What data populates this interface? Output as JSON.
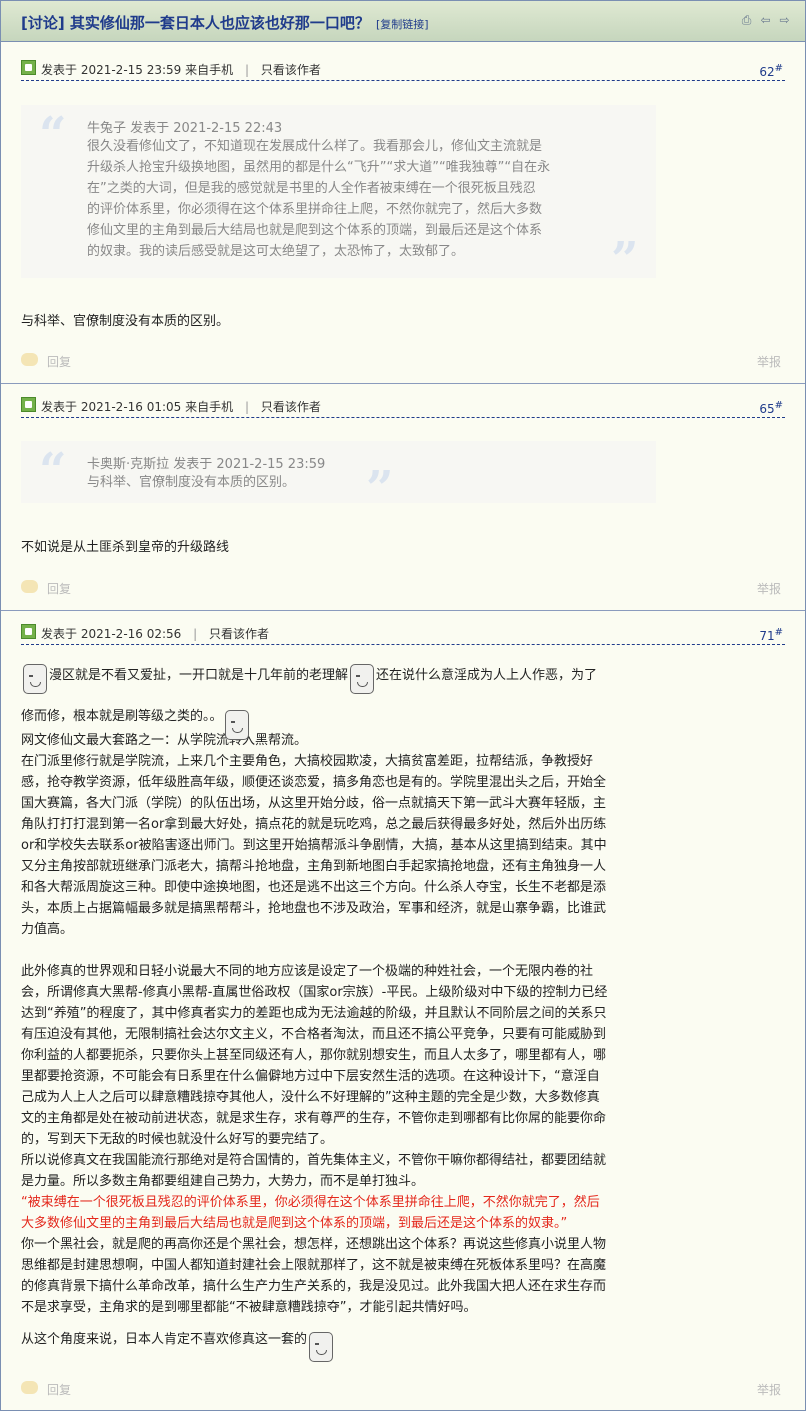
{
  "thread": {
    "title": "[讨论] 其实修仙那一套日本人也应该也好那一口吧？",
    "copy_link": "[复制链接]"
  },
  "header_icons": [
    "print-icon",
    "prev-arrow-icon",
    "next-arrow-icon"
  ],
  "posts": [
    {
      "meta_posted": "发表于 2021-2-15 23:59 来自手机",
      "only_author": "只看该作者",
      "floor_num": "62",
      "floor_sup": "#",
      "quote_head": "牛兔子 发表于 2021-2-15 22:43",
      "quote_lines": [
        "很久没看修仙文了，不知道现在发展成什么样了。我看那会儿，修仙文主流就是",
        "升级杀人抢宝升级换地图，虽然用的都是什么“飞升”“求大道”“唯我独尊”“自在永",
        "在”之类的大词，但是我的感觉就是书里的人全作者被束缚在一个很死板且残忍",
        "的评价体系里，你必须得在这个体系里拼命往上爬，不然你就完了，然后大多数",
        "修仙文里的主角到最后大结局也就是爬到这个体系的顶端，到最后还是这个体系",
        "的奴隶。我的读后感受就是这可太绝望了，太恐怖了，太致郁了。"
      ],
      "body": "与科举、官僚制度没有本质的区别。",
      "reply": "回复",
      "report": "举报"
    },
    {
      "meta_posted": "发表于 2021-2-16 01:05 来自手机",
      "only_author": "只看该作者",
      "floor_num": "65",
      "floor_sup": "#",
      "quote_head": "卡奥斯·克斯拉 发表于 2021-2-15 23:59",
      "quote_lines": [
        "与科举、官僚制度没有本质的区别。"
      ],
      "body": "不如说是从土匪杀到皇帝的升级路线",
      "reply": "回复",
      "report": "举报"
    },
    {
      "meta_posted": "发表于 2021-2-16 02:56",
      "only_author": "只看该作者",
      "floor_num": "71",
      "floor_sup": "#",
      "line1a": "漫区就是不看又爱扯，一开口就是十几年前的老理解",
      "line1b": "还在说什么意淫成为人上人作恶，为了",
      "line2": "修而修，根本就是刷等级之类的。。",
      "lines": [
        "网文修仙文最大套路之一：从学院流转入黑帮流。",
        "在门派里修行就是学院流，上来几个主要角色，大搞校园欺凌，大搞贫富差距，拉帮结派，争教授好",
        "感，抢夺教学资源，低年级胜高年级，顺便还谈恋爱，搞多角恋也是有的。学院里混出头之后，开始全",
        "国大赛篇，各大门派（学院）的队伍出场，从这里开始分歧，俗一点就搞天下第一武斗大赛年轻版，主",
        "角队打打打混到第一名or拿到最大好处，搞点花的就是玩吃鸡，总之最后获得最多好处，然后外出历练",
        "or和学校失去联系or被陷害逐出师门。到这里开始搞帮派斗争剧情，大搞，基本从这里搞到结束。其中",
        "又分主角按部就班继承门派老大，搞帮斗抢地盘，主角到新地图白手起家搞抢地盘，还有主角独身一人",
        "和各大帮派周旋这三种。即使中途换地图，也还是逃不出这三个方向。什么杀人夺宝，长生不老都是添",
        "头，本质上占据篇幅最多就是搞黑帮帮斗，抢地盘也不涉及政治，军事和经济，就是山寨争霸，比谁武",
        "力值高。",
        "",
        "此外修真的世界观和日轻小说最大不同的地方应该是设定了一个极端的种姓社会，一个无限内卷的社",
        "会，所谓修真大黑帮-修真小黑帮-直属世俗政权（国家or宗族）-平民。上级阶级对中下级的控制力已经",
        "达到“养殖”的程度了，其中修真者实力的差距也成为无法逾越的阶级，并且默认不同阶层之间的关系只",
        "有压迫没有其他，无限制搞社会达尔文主义，不合格者淘汰，而且还不搞公平竞争，只要有可能威胁到",
        "你利益的人都要扼杀，只要你头上甚至同级还有人，那你就别想安生，而且人太多了，哪里都有人，哪",
        "里都要抢资源，不可能会有日系里在什么偏僻地方过中下层安然生活的选项。在这种设计下，“意淫自",
        "己成为人上人之后可以肆意糟践掠夺其他人，没什么不好理解的”这种主题的完全是少数，大多数修真",
        "文的主角都是处在被动前进状态，就是求生存，求有尊严的生存，不管你走到哪都有比你屌的能要你命",
        "的，写到天下无敌的时候也就没什么好写的要完结了。",
        "所以说修真文在我国能流行那绝对是符合国情的，首先集体主义，不管你干嘛你都得结社，都要团结就",
        "是力量。所以多数主角都要组建自己势力，大势力，而不是单打独斗。"
      ],
      "red_lines": [
        "“被束缚在一个很死板且残忍的评价体系里，你必须得在这个体系里拼命往上爬，不然你就完了，然后",
        "大多数修仙文里的主角到最后大结局也就是爬到这个体系的顶端，到最后还是这个体系的奴隶。”"
      ],
      "after_lines": [
        "你一个黑社会，就是爬的再高你还是个黑社会，想怎样，还想跳出这个体系？再说这些修真小说里人物",
        "思维都是封建思想啊，中国人都知道封建社会上限就那样了，这不就是被束缚在死板体系里吗？在高魔",
        "的修真背景下搞什么革命改革，搞什么生产力生产关系的，我是没见过。此外我国大把人还在求生存而",
        "不是求享受，主角求的是到哪里都能“不被肆意糟践掠夺”，才能引起共情好吗。"
      ],
      "last_line": "从这个角度来说，日本人肯定不喜欢修真这一套的",
      "reply": "回复",
      "report": "举报"
    }
  ]
}
